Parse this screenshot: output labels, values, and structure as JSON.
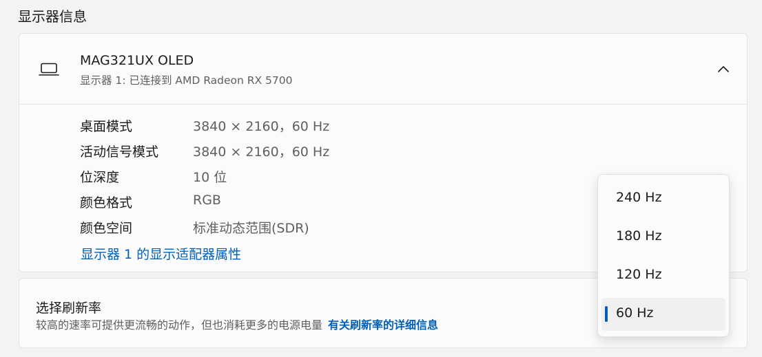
{
  "section_title": "显示器信息",
  "monitor": {
    "name": "MAG321UX OLED",
    "subtitle": "显示器 1: 已连接到 AMD Radeon RX 5700",
    "details": [
      {
        "label": "桌面模式",
        "value": "3840 × 2160，60 Hz"
      },
      {
        "label": "活动信号模式",
        "value": "3840 × 2160，60 Hz"
      },
      {
        "label": "位深度",
        "value": "10 位"
      },
      {
        "label": "颜色格式",
        "value": "RGB"
      },
      {
        "label": "颜色空间",
        "value": "标准动态范围(SDR)"
      }
    ],
    "adapter_link": "显示器 1 的显示适配器属性"
  },
  "refresh": {
    "title": "选择刷新率",
    "description": "较高的速率可提供更流畅的动作，但也消耗更多的电源电量",
    "link": "有关刷新率的详细信息"
  },
  "dropdown": {
    "options": [
      "240 Hz",
      "180 Hz",
      "120 Hz",
      "60 Hz"
    ],
    "selected": "60 Hz"
  },
  "icons": {
    "monitor": "laptop-icon",
    "expand": "chevron-up-icon"
  },
  "colors": {
    "accent": "#005fb8",
    "background": "#f3f3f3",
    "card": "#fbfbfb"
  }
}
